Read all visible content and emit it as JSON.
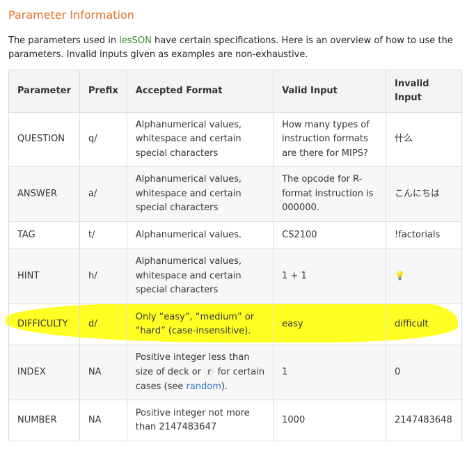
{
  "section": {
    "title": "Parameter Information",
    "intro_pre": "The parameters used in ",
    "intro_brand": "lesSON",
    "intro_post": " have certain specifications. Here is an overview of how to use the parameters. Invalid inputs given as examples are non-exhaustive."
  },
  "table": {
    "headers": [
      "Parameter",
      "Prefix",
      "Accepted Format",
      "Valid Input",
      "Invalid Input"
    ],
    "rows": [
      {
        "param": "QUESTION",
        "prefix": "q/",
        "format": "Alphanumerical values, whitespace and certain special characters",
        "valid": "How many types of instruction formats are there for MIPS?",
        "invalid": "什么"
      },
      {
        "param": "ANSWER",
        "prefix": "a/",
        "format": "Alphanumerical values, whitespace and certain special characters",
        "valid": "The opcode for R-format instruction is 000000.",
        "invalid": "こんにちは"
      },
      {
        "param": "TAG",
        "prefix": "t/",
        "format": "Alphanumerical values.",
        "valid": "CS2100",
        "invalid": "!factorials"
      },
      {
        "param": "HINT",
        "prefix": "h/",
        "format": "Alphanumerical values, whitespace and certain special characters",
        "valid": "1 + 1",
        "invalid": "💡"
      },
      {
        "param": "DIFFICULTY",
        "prefix": "d/",
        "format": "Only “easy”, “medium” or “hard” (case-insensitive).",
        "valid": "easy",
        "invalid": "difficult"
      },
      {
        "param": "INDEX",
        "prefix": "NA",
        "format_pre": "Positive integer less than size of deck or ",
        "format_code": "r",
        "format_mid": " for certain cases (see ",
        "format_link": "random",
        "format_post": ").",
        "valid": "1",
        "invalid": "0"
      },
      {
        "param": "NUMBER",
        "prefix": "NA",
        "format": "Positive integer not more than 2147483647",
        "valid": "1000",
        "invalid": "2147483648"
      }
    ]
  },
  "highlight_color": "#ffff1a"
}
